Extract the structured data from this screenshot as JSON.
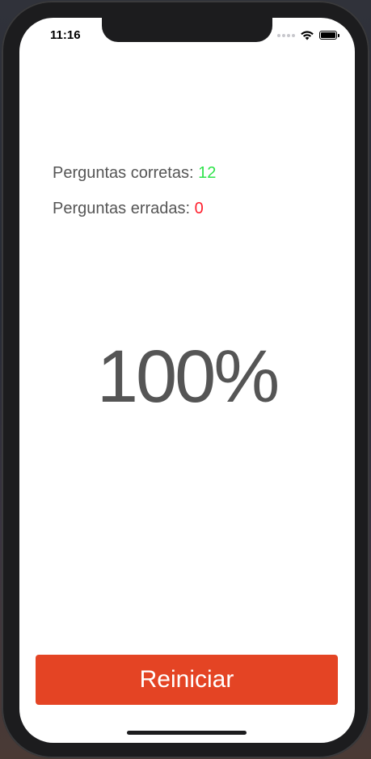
{
  "status_bar": {
    "time": "11:16"
  },
  "results": {
    "correct_label": "Perguntas corretas:",
    "correct_value": "12",
    "wrong_label": "Perguntas erradas:",
    "wrong_value": "0",
    "percentage": "100%"
  },
  "actions": {
    "restart_label": "Reiniciar"
  },
  "colors": {
    "accent_button": "#e44424",
    "correct": "#2ee34a",
    "wrong": "#ff1f2d",
    "text": "#555555"
  },
  "icons": {
    "signal": "cellular-signal-icon",
    "wifi": "wifi-icon",
    "battery": "battery-icon"
  }
}
